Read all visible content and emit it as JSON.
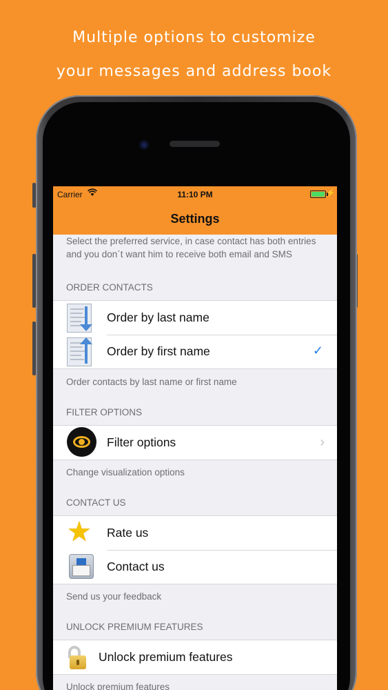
{
  "promo": {
    "line1": "Multiple options to customize",
    "line2": "your messages and address book"
  },
  "status_bar": {
    "carrier": "Carrier",
    "time": "11:10 PM",
    "wifi_icon": "wifi-icon",
    "battery_icon": "battery-icon"
  },
  "nav": {
    "title": "Settings"
  },
  "service": {
    "footer": "Select the preferred service, in case contact has both entries and you don´t want him to receive both email and SMS"
  },
  "order_contacts": {
    "header": "ORDER CONTACTS",
    "rows": [
      {
        "label": "Order by last name",
        "icon": "sort-down-icon",
        "selected": false
      },
      {
        "label": "Order by first name",
        "icon": "sort-up-icon",
        "selected": true,
        "check": "✓"
      }
    ],
    "footer": "Order contacts by last name or first name"
  },
  "filter_options": {
    "header": "FILTER OPTIONS",
    "rows": [
      {
        "label": "Filter options",
        "icon": "eye-icon",
        "chevron": "›"
      }
    ],
    "footer": "Change visualization options"
  },
  "contact_us": {
    "header": "CONTACT US",
    "rows": [
      {
        "label": "Rate us",
        "icon": "star-icon",
        "glyph": "★"
      },
      {
        "label": "Contact us",
        "icon": "mail-icon"
      }
    ],
    "footer": "Send us your feedback"
  },
  "unlock": {
    "header": "UNLOCK PREMIUM FEATURES",
    "rows": [
      {
        "label": "Unlock premium features",
        "icon": "lock-icon"
      }
    ],
    "footer": "Unlock premium features"
  },
  "colors": {
    "accent": "#f7922a",
    "check": "#1f7bea",
    "table_bg": "#efeff4"
  }
}
